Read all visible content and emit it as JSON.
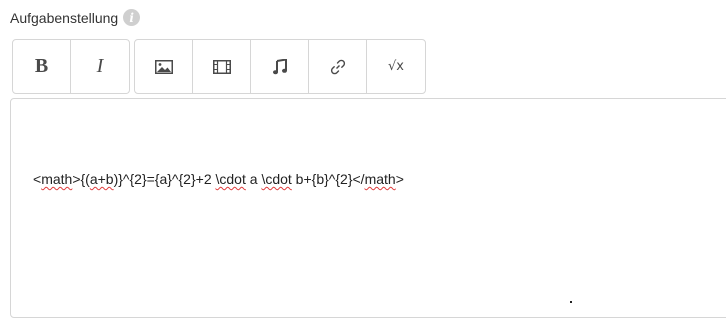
{
  "field": {
    "label": "Aufgabenstellung",
    "info_icon": "info-icon"
  },
  "toolbar": {
    "groups": [
      [
        {
          "name": "bold",
          "glyph": "B",
          "icon": "bold-icon"
        },
        {
          "name": "italic",
          "glyph": "I",
          "icon": "italic-icon"
        }
      ],
      [
        {
          "name": "image",
          "icon": "image-icon"
        },
        {
          "name": "video",
          "icon": "film-icon"
        },
        {
          "name": "audio",
          "icon": "music-note-icon"
        },
        {
          "name": "link",
          "icon": "link-icon"
        },
        {
          "name": "formula",
          "glyph": "√x",
          "icon": "square-root-icon"
        }
      ]
    ]
  },
  "editor": {
    "segments": [
      {
        "text": "<",
        "sq": false
      },
      {
        "text": "math",
        "sq": true
      },
      {
        "text": ">{(",
        "sq": false
      },
      {
        "text": "a+b",
        "sq": true
      },
      {
        "text": ")}^{2}={a}^{2}+2 ",
        "sq": false
      },
      {
        "text": "\\cdot",
        "sq": true
      },
      {
        "text": " a ",
        "sq": false
      },
      {
        "text": "\\cdot",
        "sq": true
      },
      {
        "text": " b+{b}^{2}</",
        "sq": false
      },
      {
        "text": "math",
        "sq": true
      },
      {
        "text": ">",
        "sq": false
      }
    ]
  },
  "colors": {
    "border": "#d6d6d6",
    "spellcheck": "#e03b3b",
    "info_icon_bg": "#cfcfcf"
  }
}
